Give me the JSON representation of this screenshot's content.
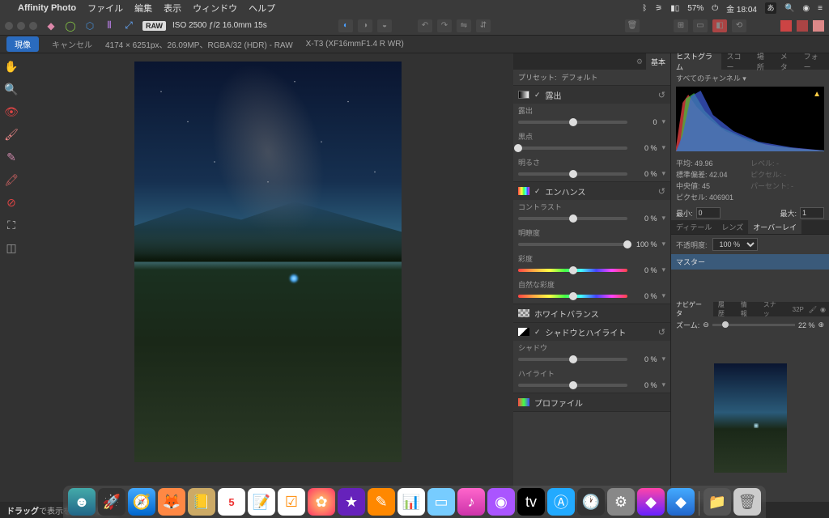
{
  "menubar": {
    "app": "Affinity Photo",
    "items": [
      "ファイル",
      "編集",
      "表示",
      "ウィンドウ",
      "ヘルプ"
    ],
    "battery": "57%",
    "clock": "金 18:04",
    "lang": "あ"
  },
  "toolbar": {
    "raw": "RAW",
    "iso": "ISO 2500 ƒ/2 16.0mm 15s"
  },
  "toolbar2": {
    "develop": "現像",
    "cancel": "キャンセル",
    "info": "4174 × 6251px、26.09MP、RGBA/32 (HDR) - RAW",
    "camera": "X-T3 (XF16mmF1.4 R WR)"
  },
  "panels": {
    "basic_tab": "基本",
    "preset_label": "プリセット:",
    "preset_value": "デフォルト",
    "exposure": {
      "title": "露出",
      "exposure_lbl": "露出",
      "exposure_val": "0",
      "black_lbl": "黒点",
      "black_val": "0 %",
      "bright_lbl": "明るさ",
      "bright_val": "0 %"
    },
    "enhance": {
      "title": "エンハンス",
      "contrast_lbl": "コントラスト",
      "contrast_val": "0 %",
      "clarity_lbl": "明瞭度",
      "clarity_val": "100 %",
      "sat_lbl": "彩度",
      "sat_val": "0 %",
      "vib_lbl": "自然な彩度",
      "vib_val": "0 %"
    },
    "wb": {
      "title": "ホワイトバランス"
    },
    "shadows": {
      "title": "シャドウとハイライト",
      "sh_lbl": "シャドウ",
      "sh_val": "0 %",
      "hi_lbl": "ハイライト",
      "hi_val": "0 %"
    },
    "profile": {
      "title": "プロファイル"
    }
  },
  "histogram": {
    "tab": "ヒストグラム",
    "tabs_other": [
      "スコー",
      "場所",
      "メタ",
      "フォー"
    ],
    "channel": "すべてのチャンネル",
    "stats": {
      "mean_lbl": "平均:",
      "mean": "49.96",
      "std_lbl": "標準偏差:",
      "std": "42.04",
      "median_lbl": "中央値:",
      "median": "45",
      "pixels_lbl": "ピクセル:",
      "pixels": "406901",
      "level_lbl": "レベル:",
      "pixel2_lbl": "ピクセル:",
      "percent_lbl": "パーセント:"
    },
    "min_lbl": "最小:",
    "min": "0",
    "max_lbl": "最大:",
    "max": "1"
  },
  "overlay": {
    "tabs": [
      "ディテール",
      "レンズ",
      "オーバーレイ"
    ],
    "opacity_lbl": "不透明度:",
    "opacity_val": "100 %",
    "master": "マスター"
  },
  "navigator": {
    "tab": "ナビゲータ",
    "tabs_other": [
      "履歴",
      "情報",
      "スナッ",
      "32P"
    ],
    "zoom_lbl": "ズーム:",
    "zoom_val": "22 %"
  },
  "status": {
    "drag": "ドラッグ",
    "rest": "で表示をパンします。"
  }
}
